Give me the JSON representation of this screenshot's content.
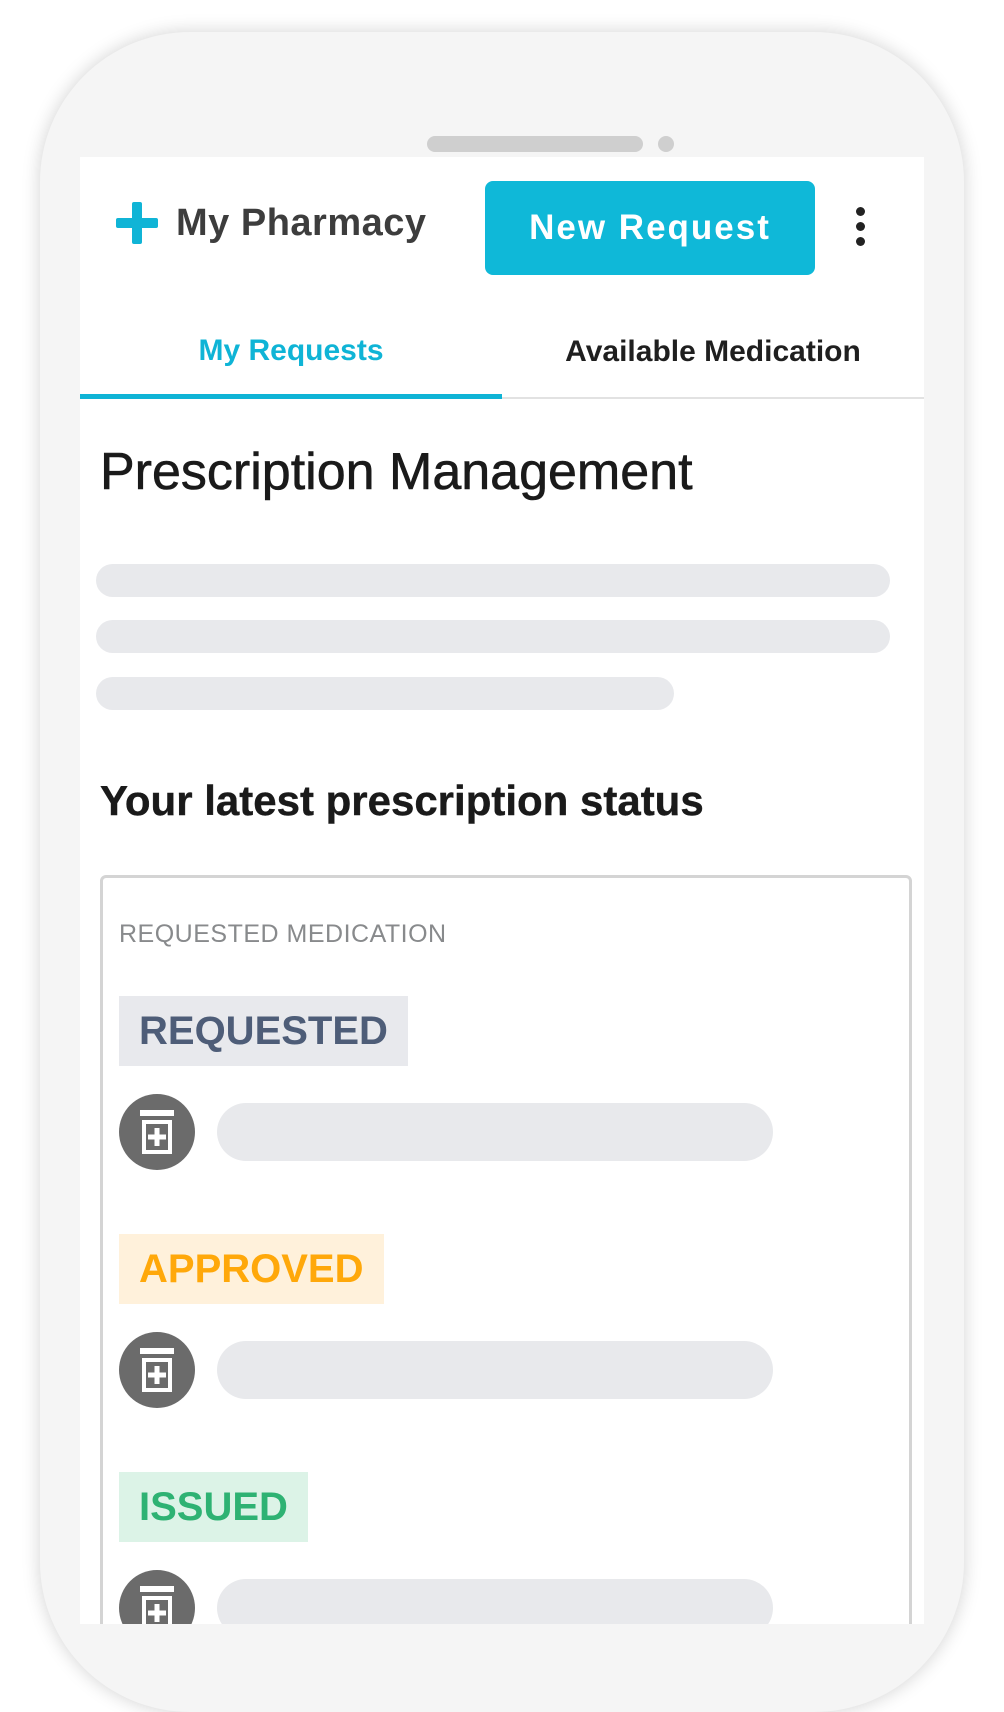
{
  "header": {
    "brand_name": "My Pharmacy",
    "new_request_label": "New Request"
  },
  "tabs": [
    {
      "label": "My Requests",
      "active": true
    },
    {
      "label": "Available Medication",
      "active": false
    }
  ],
  "main": {
    "title": "Prescription Management",
    "status_heading": "Your latest prescription status",
    "card": {
      "label": "REQUESTED MEDICATION",
      "statuses": [
        {
          "label": "REQUESTED",
          "color": "#4e5d78",
          "background": "#e8e9ed"
        },
        {
          "label": "APPROVED",
          "color": "#ffa80a",
          "background": "#fff1db"
        },
        {
          "label": "ISSUED",
          "color": "#2eb273",
          "background": "#dcf3e7"
        }
      ]
    }
  },
  "colors": {
    "accent": "#0fb8d8",
    "skeleton": "#e8e9ec",
    "icon_circle": "#6b6b6b"
  },
  "icons": {
    "brand": "plus-icon",
    "menu": "more-vertical-icon",
    "medication": "medicine-bottle-icon"
  }
}
